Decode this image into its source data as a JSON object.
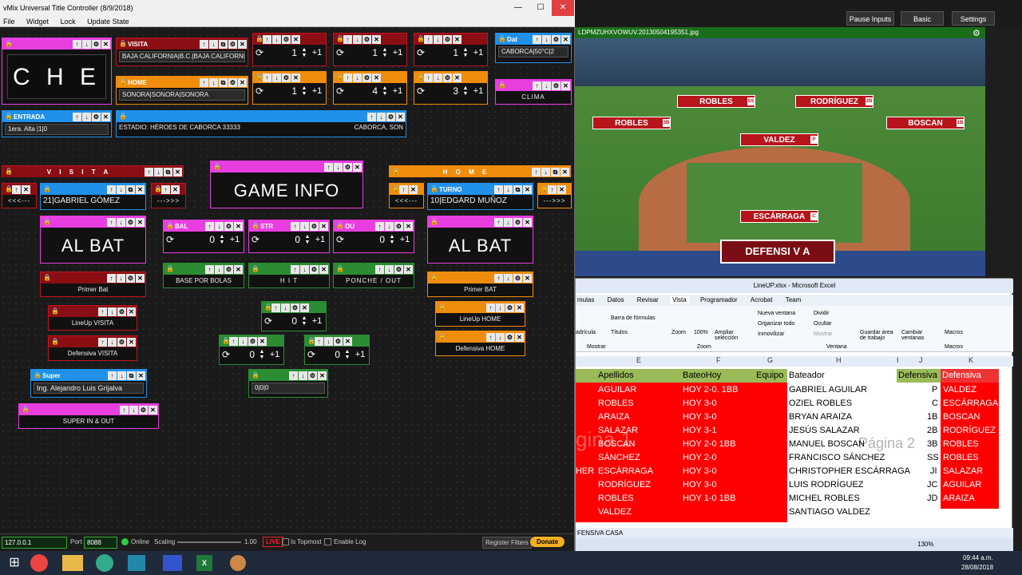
{
  "vmix": {
    "title": "vMix Universal Title Controller (8/9/2018)",
    "menu": [
      "File",
      "Widget",
      "Lock",
      "Update State"
    ]
  },
  "widgets": {
    "che": "C H E",
    "visita_label": "VISITA",
    "visita_value": "BAJA CALIFORNIA|B.C.|BAJA CALIFORNIA",
    "home_label": "HOME",
    "home_value": "SONORA|SONORA|SONORA",
    "entrada_label": "ENTRADA",
    "entrada_value": "1era. Alta |1|0",
    "estadio_value": "ESTADIO: HÉROES DE CABORCA 33333",
    "estadio_city": "CABORCA, SON",
    "date_label": "Dat",
    "date_value": "CABORCA|50°C|2",
    "clima": "CLIMA",
    "counters": [
      "1",
      "1",
      "1",
      "1",
      "4",
      "3"
    ],
    "plus1": "+1",
    "visita_hdr": "V I S I T A",
    "home_hdr": "H O M E",
    "batter_visita_value": "21|GABRIEL GÓMEZ",
    "batter_home_label": "TURNO",
    "batter_home_value": "10|EDGARD MUÑOZ",
    "prev_btn": "<<<---",
    "next_btn": "--->>>",
    "game_info": "GAME INFO",
    "al_bat": "AL BAT",
    "bal_label": "BAL",
    "str_label": "STR",
    "out_label": "OU",
    "bso_values": [
      "0",
      "0",
      "0"
    ],
    "base_por_bolas": "BASE POR BOLAS",
    "hit": "H I T",
    "ponche": "PONCHE / OUT",
    "primer_bat": "Primer Bat",
    "primer_bat_home": "Primer BAT",
    "lineup_visita": "LineUp VISITA",
    "lineup_home": "LineUp HOME",
    "defensiva_visita": "Defensiva VISITA",
    "defensiva_home": "Defensiva HOME",
    "mid_counters": [
      "0",
      "0",
      "0"
    ],
    "bases_value": "0|0|0",
    "super_label": "Super",
    "super_value": "Ing. Alejandro Luis Grijalva",
    "super_inout": "SUPER IN & OUT"
  },
  "status": {
    "ip": "127.0.0.1",
    "port_label": "Port",
    "port": "8088",
    "online": "Online",
    "scaling_label": "Scaling",
    "scaling": "1.00",
    "live": "LIVE",
    "topmost": "Is Topmost",
    "enable_log": "Enable Log",
    "register": "Register Filters",
    "donate": "Donate"
  },
  "topbar": {
    "pause": "Pause Inputs",
    "basic": "Basic",
    "settings": "Settings"
  },
  "preview": {
    "filename": "LDPMZUHXVOWUV.20130504195351.jpg",
    "banner": "DEFENSI V A",
    "players": [
      {
        "name": "ROBLES",
        "num": "SS"
      },
      {
        "name": "RODRÍGUEZ",
        "num": "2B"
      },
      {
        "name": "ROBLES",
        "num": "3B"
      },
      {
        "name": "BOSCAN",
        "num": "1B"
      },
      {
        "name": "VALDEZ",
        "num": "P"
      },
      {
        "name": "ESCÁRRAGA",
        "num": "C"
      }
    ]
  },
  "excel": {
    "title": "LineUP.xlsx - Microsoft Excel",
    "tabs": [
      "mulas",
      "Datos",
      "Revisar",
      "Vista",
      "Programador",
      "Acrobat",
      "Team"
    ],
    "ribbon": {
      "barra": "Barra de fórmulas",
      "cuadricula": "adrícula",
      "titulos": "Títulos",
      "mostrar": "Mostrar",
      "zoom": "Zoom",
      "zoom100": "100%",
      "ampliar": "Ampliar selección",
      "zoom_group": "Zoom",
      "nueva": "Nueva ventana",
      "organizar": "Organizar todo",
      "inmovilizar": "Inmovilizar",
      "dividir": "Dividir",
      "ocultar": "Ocultar",
      "mostrar2": "Mostrar",
      "guardar": "Guardar área de trabajo",
      "cambiar": "Cambiar ventanas",
      "ventana": "Ventana",
      "macros": "Macros",
      "macros_group": "Macros"
    },
    "cols": [
      "E",
      "F",
      "G",
      "H",
      "I",
      "J",
      "K"
    ],
    "headers": [
      "Apellidos",
      "BateoHoy",
      "Equipo",
      "Bateador",
      "Defensiva",
      "Defensiva"
    ],
    "rows": [
      [
        "AGUILAR",
        "HOY 2-0. 1BB",
        "GABRIEL AGUILAR",
        "P",
        "VALDEZ"
      ],
      [
        "ROBLES",
        "HOY 3-0",
        "OZIEL ROBLES",
        "C",
        "ESCÁRRAGA"
      ],
      [
        "ARAIZA",
        "HOY 3-0",
        "BRYAN ARAIZA",
        "1B",
        "BOSCAN"
      ],
      [
        "SALAZAR",
        "HOY 3-1",
        "JESÚS SALAZAR",
        "2B",
        "RODRÍGUEZ"
      ],
      [
        "BOSCAN",
        "HOY 2-0 1BB",
        "MANUEL BOSCAN",
        "3B",
        "ROBLES"
      ],
      [
        "SÁNCHEZ",
        "HOY 2-0",
        "FRANCISCO SÁNCHEZ",
        "SS",
        "ROBLES"
      ],
      [
        "ESCÁRRAGA",
        "HOY 3-0",
        "CHRISTOPHER ESCÁRRAGA",
        "JI",
        "SALAZAR"
      ],
      [
        "RODRÍGUEZ",
        "HOY 3-0",
        "LUIS RODRÍGUEZ",
        "JC",
        "AGUILAR"
      ],
      [
        "ROBLES",
        "HOY 1-0 1BB",
        "MICHEL ROBLES",
        "JD",
        "ARAIZA"
      ],
      [
        "VALDEZ",
        "",
        "SANTIAGO VALDEZ",
        "",
        ""
      ]
    ],
    "page1": "gina 1",
    "page2": "Página 2",
    "row_extra": "HER",
    "sheet": "FENSIVA CASA",
    "zoom_level": "130%"
  },
  "taskbar": {
    "time": "09:44 a.m.",
    "date": "28/08/2018"
  }
}
